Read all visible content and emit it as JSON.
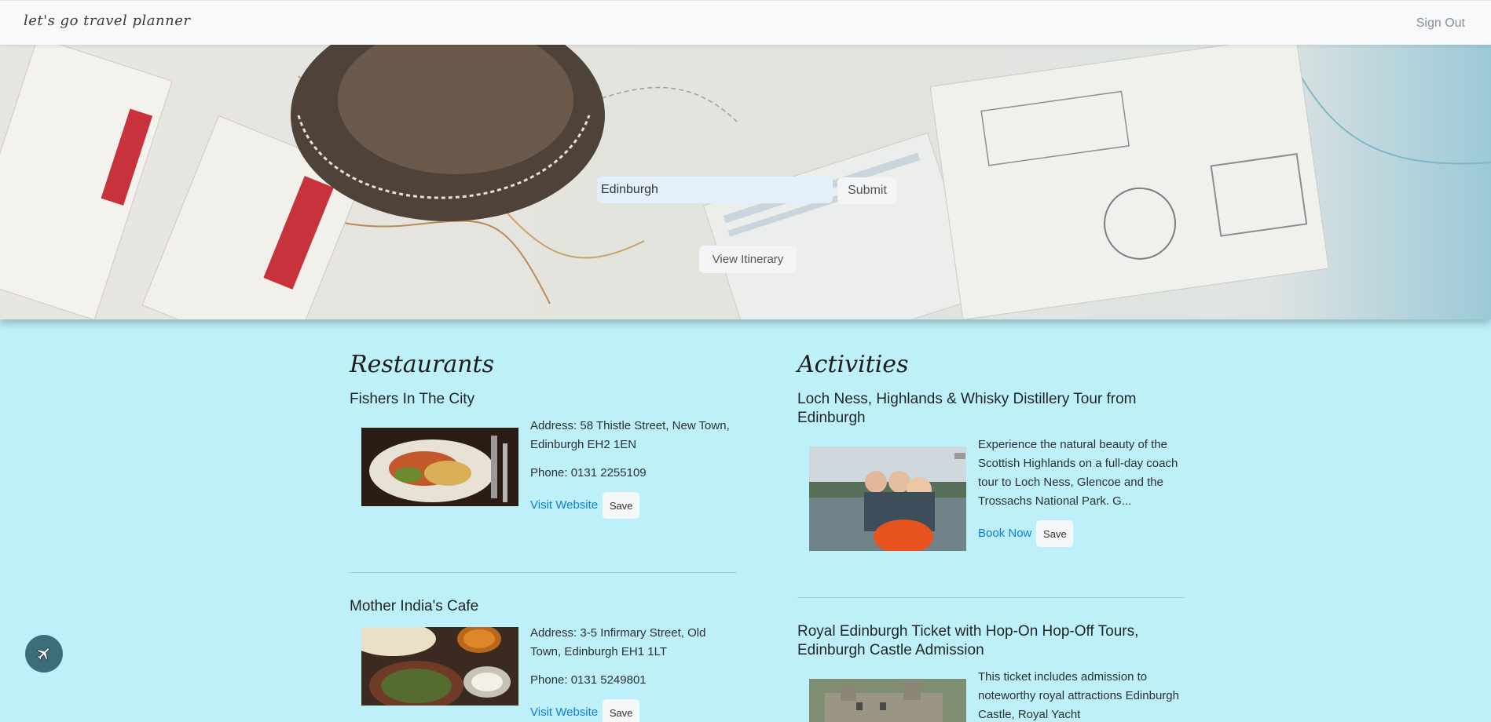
{
  "navbar": {
    "brand": "let's go travel planner",
    "sign_out": "Sign Out"
  },
  "hero": {
    "search_value": "Edinburgh",
    "submit_label": "Submit",
    "view_itinerary_label": "View Itinerary"
  },
  "restaurants": {
    "title": "Restaurants",
    "items": [
      {
        "name": "Fishers In The City",
        "address": "Address: 58 Thistle Street, New Town, Edinburgh EH2 1EN",
        "phone": "Phone: 0131 2255109",
        "link_label": "Visit Website",
        "save_label": "Save"
      },
      {
        "name": "Mother India's Cafe",
        "address": "Address: 3-5 Infirmary Street, Old Town, Edinburgh EH1 1LT",
        "phone": "Phone: 0131 5249801",
        "link_label": "Visit Website",
        "save_label": "Save"
      }
    ]
  },
  "activities": {
    "title": "Activities",
    "items": [
      {
        "name": "Loch Ness, Highlands & Whisky Distillery Tour from Edinburgh",
        "description": "Experience the natural beauty of the Scottish Highlands on a full-day coach tour to Loch Ness, Glencoe and the Trossachs National Park. G...",
        "link_label": "Book Now",
        "save_label": "Save"
      },
      {
        "name": "Royal Edinburgh Ticket with Hop-On Hop-Off Tours, Edinburgh Castle Admission",
        "description": "This ticket includes admission to noteworthy royal attractions Edinburgh Castle, Royal Yacht",
        "link_label": "",
        "save_label": ""
      }
    ]
  },
  "fab": {
    "icon": "airplane-icon"
  }
}
